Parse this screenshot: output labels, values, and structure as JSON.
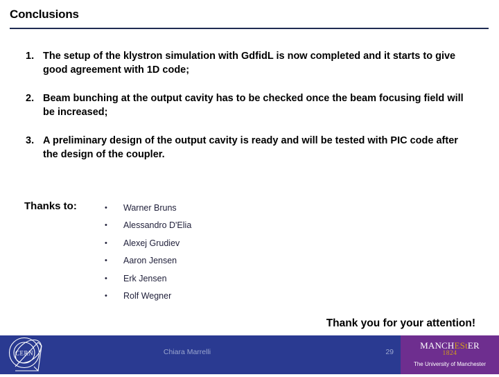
{
  "slide": {
    "title": "Conclusions",
    "accent_rule_color": "#1f2b52",
    "background_color": "#ffffff"
  },
  "conclusions": {
    "items": [
      {
        "marker": "1.",
        "text": "The setup of the klystron simulation with GdfidL is now completed and it starts to give good agreement with 1D code;"
      },
      {
        "marker": "2.",
        "text": "Beam bunching at the output cavity has to be checked once the beam focusing field will be increased;"
      },
      {
        "marker": "3.",
        "text": "A preliminary design of the output cavity is ready and will be tested with PIC code after the design of the coupler."
      }
    ]
  },
  "thanks": {
    "label": "Thanks to:",
    "bullet": "•",
    "names": [
      "Warner Bruns",
      "Alessandro D'Elia",
      "Alexej Grudiev",
      "Aaron Jensen",
      "Erk Jensen",
      "Rolf Wegner"
    ]
  },
  "closing": {
    "text": "Thank you for your attention!"
  },
  "footer": {
    "blue_color": "#2a3a91",
    "purple_color": "#6e2e8f",
    "author": "Chiara Marrelli",
    "page_number": "29",
    "cern_logo_label": "CERN",
    "manchester": {
      "word_part_1": "MANCH",
      "word_part_2": "ES",
      "word_part_3": "t",
      "word_part_4": "ER",
      "year": "1824",
      "subtitle": "The University of Manchester"
    }
  }
}
